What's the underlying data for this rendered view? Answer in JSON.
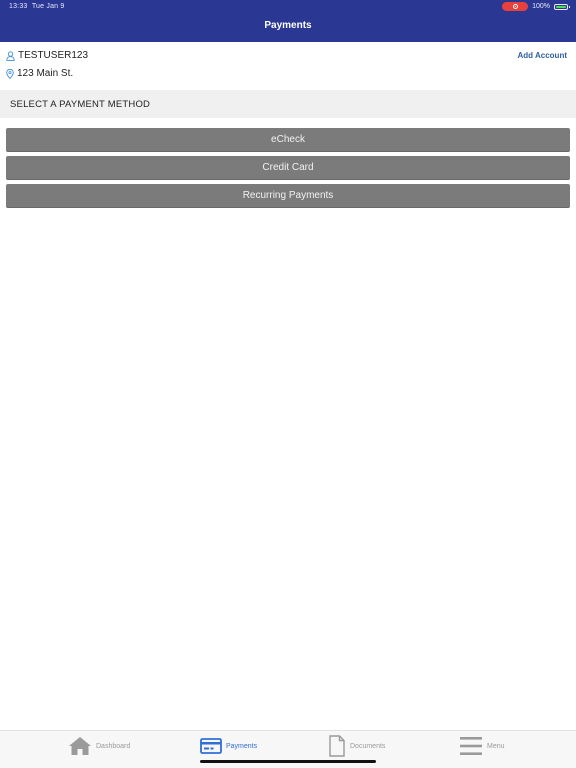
{
  "status_bar": {
    "time": "13:33",
    "date": "Tue Jan 9",
    "battery_percent": "100%"
  },
  "header": {
    "title": "Payments"
  },
  "account": {
    "username": "TESTUSER123",
    "address": "123 Main St.",
    "add_account_label": "Add Account"
  },
  "section": {
    "title": "SELECT A PAYMENT METHOD"
  },
  "payment_methods": [
    {
      "label": "eCheck"
    },
    {
      "label": "Credit Card"
    },
    {
      "label": "Recurring Payments"
    }
  ],
  "tabbar": {
    "items": [
      {
        "label": "Dashboard",
        "icon": "home-icon",
        "active": false
      },
      {
        "label": "Payments",
        "icon": "card-icon",
        "active": true
      },
      {
        "label": "Documents",
        "icon": "document-icon",
        "active": false
      },
      {
        "label": "Menu",
        "icon": "menu-icon",
        "active": false
      }
    ]
  },
  "colors": {
    "header_bg": "#2a3793",
    "button_bg": "#7b7b7b",
    "link": "#2f5f9e",
    "tab_active": "#2f6fd6",
    "tab_inactive": "#9a9a9a",
    "section_bg": "#f0f0f0"
  }
}
